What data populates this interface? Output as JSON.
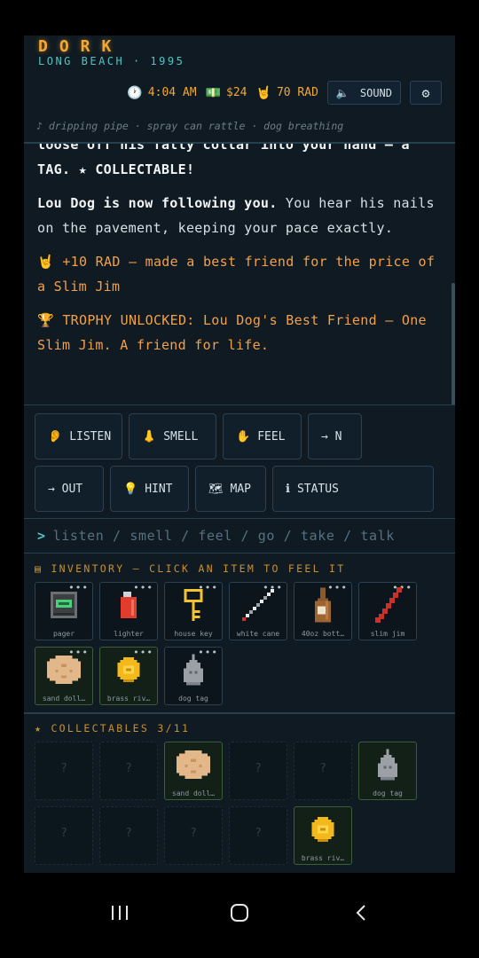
{
  "header": {
    "title": "DORK",
    "subtitle": "LONG BEACH · 1995",
    "time": "4:04 AM",
    "money": "$24",
    "rad": "70 RAD",
    "sound_label": "SOUND",
    "ambient": "♪ dripping pipe · spray can rattle · dog breathing"
  },
  "narrative": {
    "p1": "loose off his fatty collar into your hand – a TAG. ★ COLLECTABLE!",
    "p2_bold": "Lou Dog is now following you.",
    "p2_rest": " You hear his nails on the pavement, keeping your pace exactly.",
    "p3": "+10 RAD – made a best friend for the price of a Slim Jim",
    "p4": "TROPHY UNLOCKED: Lou Dog's Best Friend – One Slim Jim. A friend for life."
  },
  "actions": {
    "listen": "LISTEN",
    "smell": "SMELL",
    "feel": "FEEL",
    "north": "→ N",
    "out": "→ OUT",
    "hint": "HINT",
    "map": "MAP",
    "status": "STATUS"
  },
  "command": {
    "prompt": ">",
    "placeholder": "listen / smell / feel / go / take / talk"
  },
  "inventory": {
    "heading": "▤ INVENTORY – CLICK AN ITEM TO FEEL IT",
    "items": [
      {
        "label": "pager",
        "icon": "pager-icon"
      },
      {
        "label": "lighter",
        "icon": "lighter-icon"
      },
      {
        "label": "house key",
        "icon": "key-icon"
      },
      {
        "label": "white cane",
        "icon": "cane-icon"
      },
      {
        "label": "40oz bott…",
        "icon": "bottle-icon"
      },
      {
        "label": "slim jim",
        "icon": "slim-jim-icon"
      },
      {
        "label": "sand doll…",
        "icon": "sand-dollar-icon"
      },
      {
        "label": "brass riv…",
        "icon": "brass-rivet-icon"
      },
      {
        "label": "dog tag",
        "icon": "dog-tag-icon"
      }
    ]
  },
  "collectables": {
    "heading": "★ COLLECTABLES 3/11",
    "unknown": "?",
    "found": {
      "sand_dollar": "sand doll…",
      "dog_tag": "dog tag",
      "brass_rivet": "brass riv…"
    }
  },
  "colors": {
    "background": "#0f1a22",
    "accent_orange": "#f3a832",
    "accent_teal": "#4fc4c4",
    "border": "#2b4050"
  }
}
